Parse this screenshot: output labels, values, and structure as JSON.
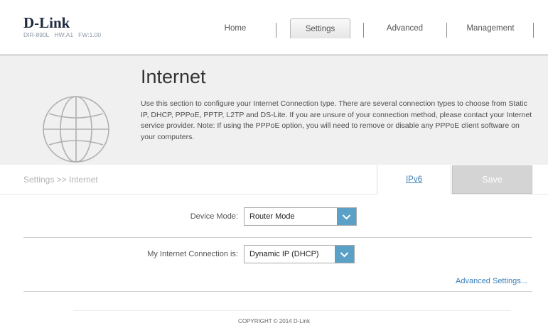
{
  "brand": {
    "logo": "D-Link",
    "model": "DIR-890L",
    "hw": "HW:A1",
    "fw": "FW:1.00"
  },
  "nav": {
    "home": "Home",
    "settings": "Settings",
    "advanced": "Advanced",
    "management": "Management"
  },
  "banner": {
    "title": "Internet",
    "description": "Use this section to configure your Internet Connection type. There are several connection types to choose from Static IP, DHCP, PPPoE, PPTP, L2TP and DS-Lite. If you are unsure of your connection method, please contact your Internet service provider. Note: If using the PPPoE option, you will need to remove or disable any PPPoE client software on your computers.",
    "icon": "globe-icon"
  },
  "breadcrumb": "Settings >> Internet",
  "actions": {
    "ipv6": "IPv6",
    "save": "Save"
  },
  "form": {
    "device_mode_label": "Device Mode:",
    "device_mode_value": "Router Mode",
    "connection_label": "My Internet Connection is:",
    "connection_value": "Dynamic IP (DHCP)"
  },
  "advanced_settings": "Advanced Settings...",
  "footer": {
    "copyright": "COPYRIGHT © 2014 D-Link"
  },
  "colors": {
    "accent": "#5aa0c7",
    "link": "#3a7fb8",
    "banner_bg": "#f0f0f0",
    "save_disabled": "#d4d4d4"
  }
}
